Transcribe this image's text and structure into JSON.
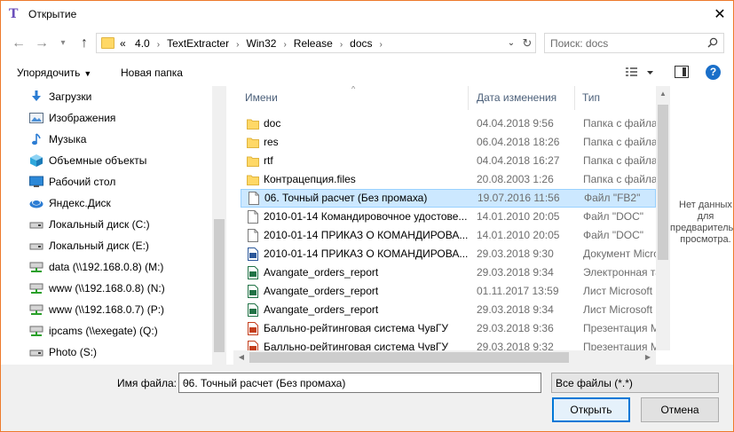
{
  "window": {
    "title": "Открытие"
  },
  "address": {
    "crumbs": [
      "«",
      "4.0",
      "TextExtracter",
      "Win32",
      "Release",
      "docs"
    ]
  },
  "search": {
    "placeholder": "Поиск: docs"
  },
  "toolbar": {
    "organize_label": "Упорядочить",
    "new_folder_label": "Новая папка"
  },
  "sidebar": {
    "items": [
      {
        "label": "Загрузки",
        "icon": "download-icon"
      },
      {
        "label": "Изображения",
        "icon": "pictures-icon"
      },
      {
        "label": "Музыка",
        "icon": "music-icon"
      },
      {
        "label": "Объемные объекты",
        "icon": "3d-objects-icon"
      },
      {
        "label": "Рабочий стол",
        "icon": "desktop-icon"
      },
      {
        "label": "Яндекс.Диск",
        "icon": "yandex-disk-icon"
      },
      {
        "label": "Локальный диск (C:)",
        "icon": "drive-icon"
      },
      {
        "label": "Локальный диск (E:)",
        "icon": "drive-icon"
      },
      {
        "label": "data (\\\\192.168.0.8) (M:)",
        "icon": "network-drive-icon"
      },
      {
        "label": "www (\\\\192.168.0.8) (N:)",
        "icon": "network-drive-icon"
      },
      {
        "label": "www (\\\\192.168.0.7) (P:)",
        "icon": "network-drive-icon"
      },
      {
        "label": "ipcams (\\\\exegate) (Q:)",
        "icon": "network-drive-icon"
      },
      {
        "label": "Photo (S:)",
        "icon": "drive-icon"
      }
    ]
  },
  "columns": {
    "name": "Имени",
    "date": "Дата изменения",
    "type": "Тип"
  },
  "files": [
    {
      "name": "doc",
      "date": "04.04.2018 9:56",
      "type": "Папка с файлами",
      "icon": "folder-icon"
    },
    {
      "name": "res",
      "date": "06.04.2018 18:26",
      "type": "Папка с файлами",
      "icon": "folder-icon"
    },
    {
      "name": "rtf",
      "date": "04.04.2018 16:27",
      "type": "Папка с файлами",
      "icon": "folder-icon"
    },
    {
      "name": "Контрацепция.files",
      "date": "20.08.2003 1:26",
      "type": "Папка с файлами",
      "icon": "folder-icon"
    },
    {
      "name": "06. Точный расчет (Без промаха)",
      "date": "19.07.2016 11:56",
      "type": "Файл \"FB2\"",
      "icon": "file-icon",
      "selected": true
    },
    {
      "name": "2010-01-14 Командировочное удостове...",
      "date": "14.01.2010 20:05",
      "type": "Файл \"DOC\"",
      "icon": "file-icon"
    },
    {
      "name": "2010-01-14 ПРИКАЗ О КОМАНДИРОВА...",
      "date": "14.01.2010 20:05",
      "type": "Файл \"DOC\"",
      "icon": "file-icon"
    },
    {
      "name": "2010-01-14 ПРИКАЗ О КОМАНДИРОВА...",
      "date": "29.03.2018 9:30",
      "type": "Документ Microsoft",
      "icon": "word-icon"
    },
    {
      "name": "Avangate_orders_report",
      "date": "29.03.2018 9:34",
      "type": "Электронная таблица",
      "icon": "excel-icon"
    },
    {
      "name": "Avangate_orders_report",
      "date": "01.11.2017 13:59",
      "type": "Лист Microsoft",
      "icon": "excel-icon"
    },
    {
      "name": "Avangate_orders_report",
      "date": "29.03.2018 9:34",
      "type": "Лист Microsoft",
      "icon": "excel-icon"
    },
    {
      "name": "Балльно-рейтинговая система ЧувГУ",
      "date": "29.03.2018 9:36",
      "type": "Презентация Microsoft",
      "icon": "powerpoint-icon"
    },
    {
      "name": "Балльно-рейтинговая система ЧувГУ",
      "date": "29.03.2018 9:32",
      "type": "Презентация Microsoft",
      "icon": "powerpoint-icon"
    }
  ],
  "preview": {
    "text": "Нет данных для предварительного просмотра."
  },
  "bottom": {
    "filename_label": "Имя файла:",
    "filename_value": "06. Точный расчет (Без промаха)",
    "filetype_value": "Все файлы (*.*)",
    "open_label": "Открыть",
    "cancel_label": "Отмена"
  },
  "colors": {
    "accent": "#0078d7",
    "window_border": "#ed7a2c",
    "selection": "#cce8ff",
    "folder": "#ffd866"
  }
}
